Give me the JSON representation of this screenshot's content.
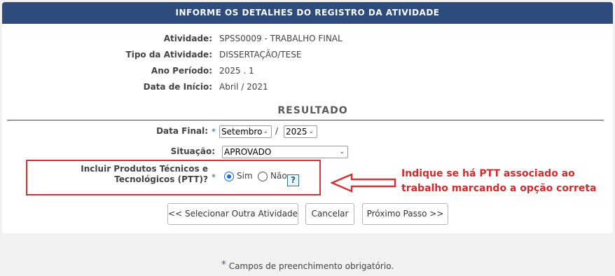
{
  "header": {
    "title": "INFORME OS DETALHES DO REGISTRO DA ATIVIDADE"
  },
  "details": [
    {
      "label": "Atividade:",
      "value": "SPSS0009 - TRABALHO FINAL"
    },
    {
      "label": "Tipo da Atividade:",
      "value": "DISSERTAÇÃO/TESE"
    },
    {
      "label": "Ano Período:",
      "value": "2025 . 1"
    },
    {
      "label": "Data de Início:",
      "value": "Abril / 2021"
    }
  ],
  "resultado": {
    "title": "RESULTADO",
    "data_final": {
      "label": "Data Final:",
      "required_mark": "*",
      "month": "Setembro",
      "separator": "/",
      "year": "2025"
    },
    "situacao": {
      "label": "Situação:",
      "value": "APROVADO"
    },
    "ptt": {
      "label": "Incluir Produtos Técnicos e Tecnológicos (PTT)?",
      "required_mark": "*",
      "option_yes": "Sim",
      "option_no": "Não",
      "selected": "Sim",
      "help": "?"
    }
  },
  "buttons": {
    "back": "<< Selecionar Outra Atividade",
    "cancel": "Cancelar",
    "next": "Próximo Passo >>"
  },
  "annotation": {
    "text": "Indique se há PTT associado ao trabalho marcando a opção correta",
    "color": "#d42a2a"
  },
  "footer": {
    "required_mark": "*",
    "note": "Campos de preenchimento obrigatório."
  },
  "colors": {
    "header_bg": "#2d4b7d",
    "accent": "#1a6bd1",
    "annotation_red": "#d13434"
  }
}
